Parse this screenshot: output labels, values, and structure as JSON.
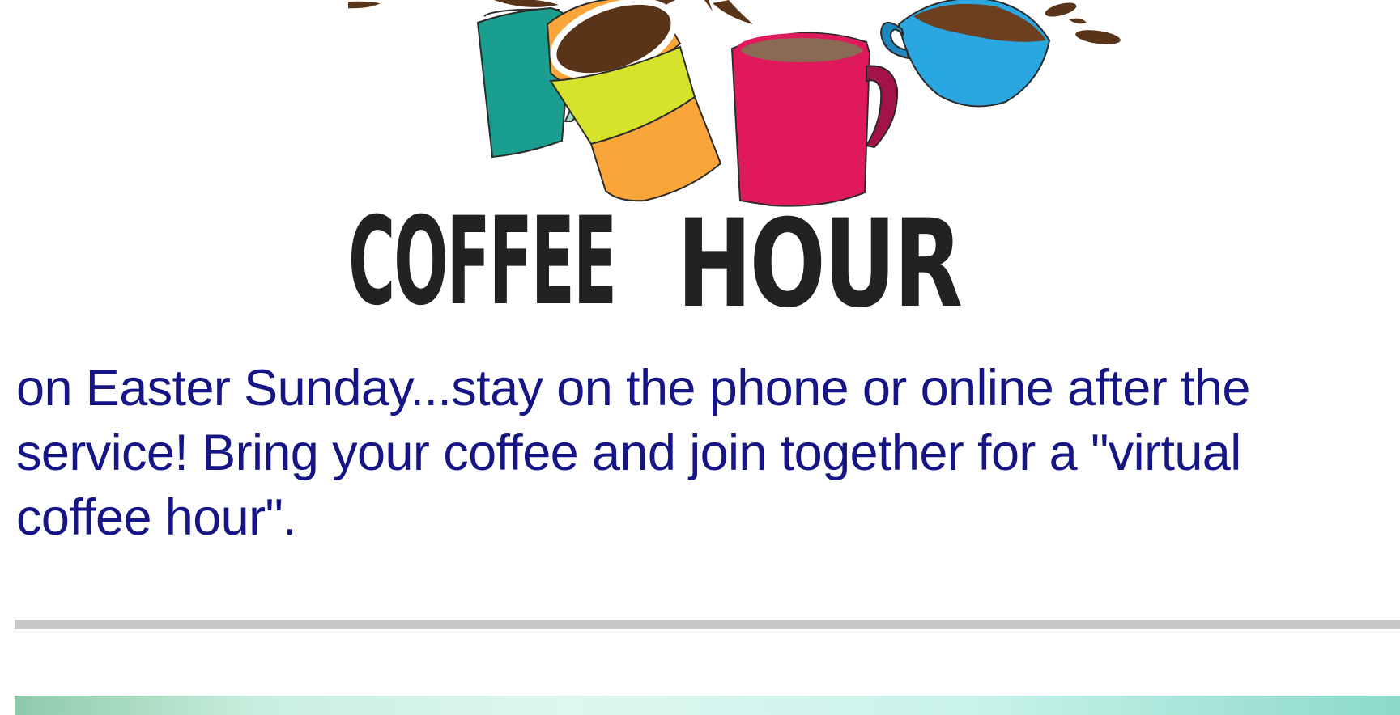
{
  "banner": {
    "title": "COFFEE HOUR",
    "icons": [
      "teal-mug-icon",
      "paper-cup-icon",
      "red-mug-icon",
      "blue-cup-icon",
      "coffee-splash-icon"
    ]
  },
  "announcement": {
    "text": "on Easter Sunday...stay on the phone or online after the service!  Bring your coffee and join together for a \"virtual coffee hour\"."
  },
  "colors": {
    "text": "#151586",
    "divider": "#c8c8c8",
    "teal_mug": "#1a9e8f",
    "cup_orange": "#f9a53a",
    "cup_band": "#d6e32a",
    "red_mug": "#e0195c",
    "blue_cup": "#2aa7e0",
    "coffee": "#5a3418"
  }
}
